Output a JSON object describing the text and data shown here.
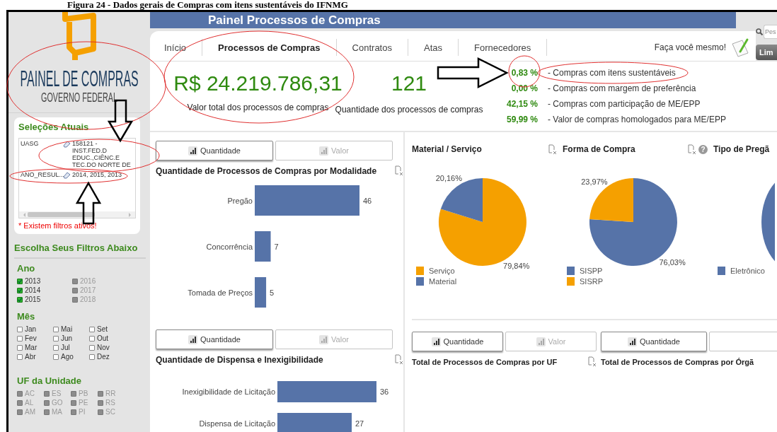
{
  "caption": "Figura 24 - Dados gerais de Compras com itens sustentáveis do IFNMG",
  "sidebar": {
    "logo": {
      "title": "PAINEL DE COMPRAS",
      "subtitle": "GOVERNO FEDERAL"
    },
    "selections": {
      "title": "Seleções Atuais",
      "rows": [
        {
          "field": "UASG",
          "value": "158121 - INST.FED.D EDUC.,CIÊNC.E TEC.DO NORTE DE"
        },
        {
          "field": "ANO_RESUL...",
          "value": "2014, 2015, 2013"
        }
      ],
      "warning": "* Existem filtros ativos!"
    },
    "filters_title": "Escolha Seus Filtros Abaixo",
    "filters": [
      {
        "title": "Ano",
        "items": [
          {
            "label": "2013",
            "checked": true,
            "disabled": false
          },
          {
            "label": "2014",
            "checked": true,
            "disabled": false
          },
          {
            "label": "2015",
            "checked": true,
            "disabled": false
          },
          {
            "label": "2016",
            "checked": false,
            "disabled": true
          },
          {
            "label": "2017",
            "checked": false,
            "disabled": true
          },
          {
            "label": "2018",
            "checked": false,
            "disabled": true
          }
        ]
      },
      {
        "title": "Mês",
        "items": [
          {
            "label": "Jan",
            "checked": false,
            "disabled": false
          },
          {
            "label": "Fev",
            "checked": false,
            "disabled": false
          },
          {
            "label": "Mar",
            "checked": false,
            "disabled": false
          },
          {
            "label": "Abr",
            "checked": false,
            "disabled": false
          },
          {
            "label": "Mai",
            "checked": false,
            "disabled": false
          },
          {
            "label": "Jun",
            "checked": false,
            "disabled": false
          },
          {
            "label": "Jul",
            "checked": false,
            "disabled": false
          },
          {
            "label": "Ago",
            "checked": false,
            "disabled": false
          },
          {
            "label": "Set",
            "checked": false,
            "disabled": false
          },
          {
            "label": "Out",
            "checked": false,
            "disabled": false
          },
          {
            "label": "Nov",
            "checked": false,
            "disabled": false
          },
          {
            "label": "Dez",
            "checked": false,
            "disabled": false
          }
        ]
      },
      {
        "title": "UF da Unidade",
        "items": [
          {
            "label": "AC",
            "checked": false,
            "disabled": true
          },
          {
            "label": "AL",
            "checked": false,
            "disabled": true
          },
          {
            "label": "AM",
            "checked": false,
            "disabled": true
          },
          {
            "label": "ES",
            "checked": false,
            "disabled": true
          },
          {
            "label": "GO",
            "checked": false,
            "disabled": true
          },
          {
            "label": "MA",
            "checked": false,
            "disabled": true
          },
          {
            "label": "PB",
            "checked": false,
            "disabled": true
          },
          {
            "label": "PE",
            "checked": false,
            "disabled": true
          },
          {
            "label": "PI",
            "checked": false,
            "disabled": true
          },
          {
            "label": "RR",
            "checked": false,
            "disabled": true
          },
          {
            "label": "RS",
            "checked": false,
            "disabled": true
          },
          {
            "label": "SC",
            "checked": false,
            "disabled": true
          }
        ]
      }
    ]
  },
  "header": {
    "title": "Painel Processos de Compras"
  },
  "search": {
    "placeholder": "Pes"
  },
  "clear_button": "Lim",
  "tabs": [
    {
      "label": "Início",
      "selected": false
    },
    {
      "label": "Processos de Compras",
      "selected": true
    },
    {
      "label": "Contratos",
      "selected": false
    },
    {
      "label": "Atas",
      "selected": false
    },
    {
      "label": "Fornecedores",
      "selected": false
    }
  ],
  "diy_link": "Faça você mesmo!",
  "kpis": [
    {
      "value": "R$ 24.219.786,31",
      "label": "Valor total dos processos de compras"
    },
    {
      "value": "121",
      "label": "Quantidade dos processos de compras"
    }
  ],
  "indicators": [
    {
      "value": "0,83 %",
      "label": "- Compras com itens sustentáveis"
    },
    {
      "value": "0,00 %",
      "label": "- Compras com margem de preferência"
    },
    {
      "value": "42,15 %",
      "label": "- Compras com participação de ME/EPP"
    },
    {
      "value": "59,99 %",
      "label": "- Valor de compras homologados para ME/EPP"
    }
  ],
  "bar_panels": [
    {
      "toggles": [
        {
          "label": "Quantidade",
          "selected": true
        },
        {
          "label": "Valor",
          "selected": false
        }
      ],
      "chart_data": {
        "type": "bar",
        "orientation": "horizontal",
        "title": "Quantidade de Processos de Compras por Modalidade",
        "categories": [
          "Pregão",
          "Concorrência",
          "Tomada de Preços"
        ],
        "values": [
          46,
          7,
          5
        ],
        "data_labels": true
      }
    },
    {
      "toggles": [
        {
          "label": "Quantidade",
          "selected": true
        },
        {
          "label": "Valor",
          "selected": false
        }
      ],
      "chart_data": {
        "type": "bar",
        "orientation": "horizontal",
        "title": "Quantidade de Dispensa e Inexigibilidade",
        "categories": [
          "Inexigibilidade de Licitação",
          "Dispensa de Licitação"
        ],
        "values": [
          36,
          27
        ],
        "data_labels": true
      }
    }
  ],
  "pie_panels": [
    {
      "kind": "chart",
      "chart_data": {
        "type": "pie",
        "title": "Material / Serviço",
        "categories": [
          "Serviço",
          "Material"
        ],
        "values": [
          79.84,
          20.16
        ],
        "value_labels": [
          "79,84%",
          "20,16%"
        ],
        "colors": [
          "#f5a000",
          "#5673a8"
        ]
      }
    },
    {
      "kind": "chart",
      "help": "?",
      "chart_data": {
        "type": "pie",
        "title": "Forma de Compra",
        "categories": [
          "SISPP",
          "SISRP"
        ],
        "values": [
          76.03,
          23.97
        ],
        "value_labels": [
          "76,03%",
          "23,97%"
        ],
        "colors": [
          "#5673a8",
          "#f5a000"
        ]
      }
    },
    {
      "kind": "partial",
      "title": "Tipo de Pregã",
      "legend": [
        {
          "label": "Eletrônico",
          "color": "#5673a8"
        }
      ]
    }
  ],
  "bottom_panels": [
    {
      "toggles": [
        {
          "label": "Quantidade",
          "selected": true
        },
        {
          "label": "Valor",
          "selected": false
        }
      ],
      "title": "Total de Processos de Compras por UF"
    },
    {
      "toggles": [
        {
          "label": "Quantidade",
          "selected": true
        },
        {
          "selected": false
        }
      ],
      "title": "Total de Processos de Compras por Órgã"
    }
  ]
}
